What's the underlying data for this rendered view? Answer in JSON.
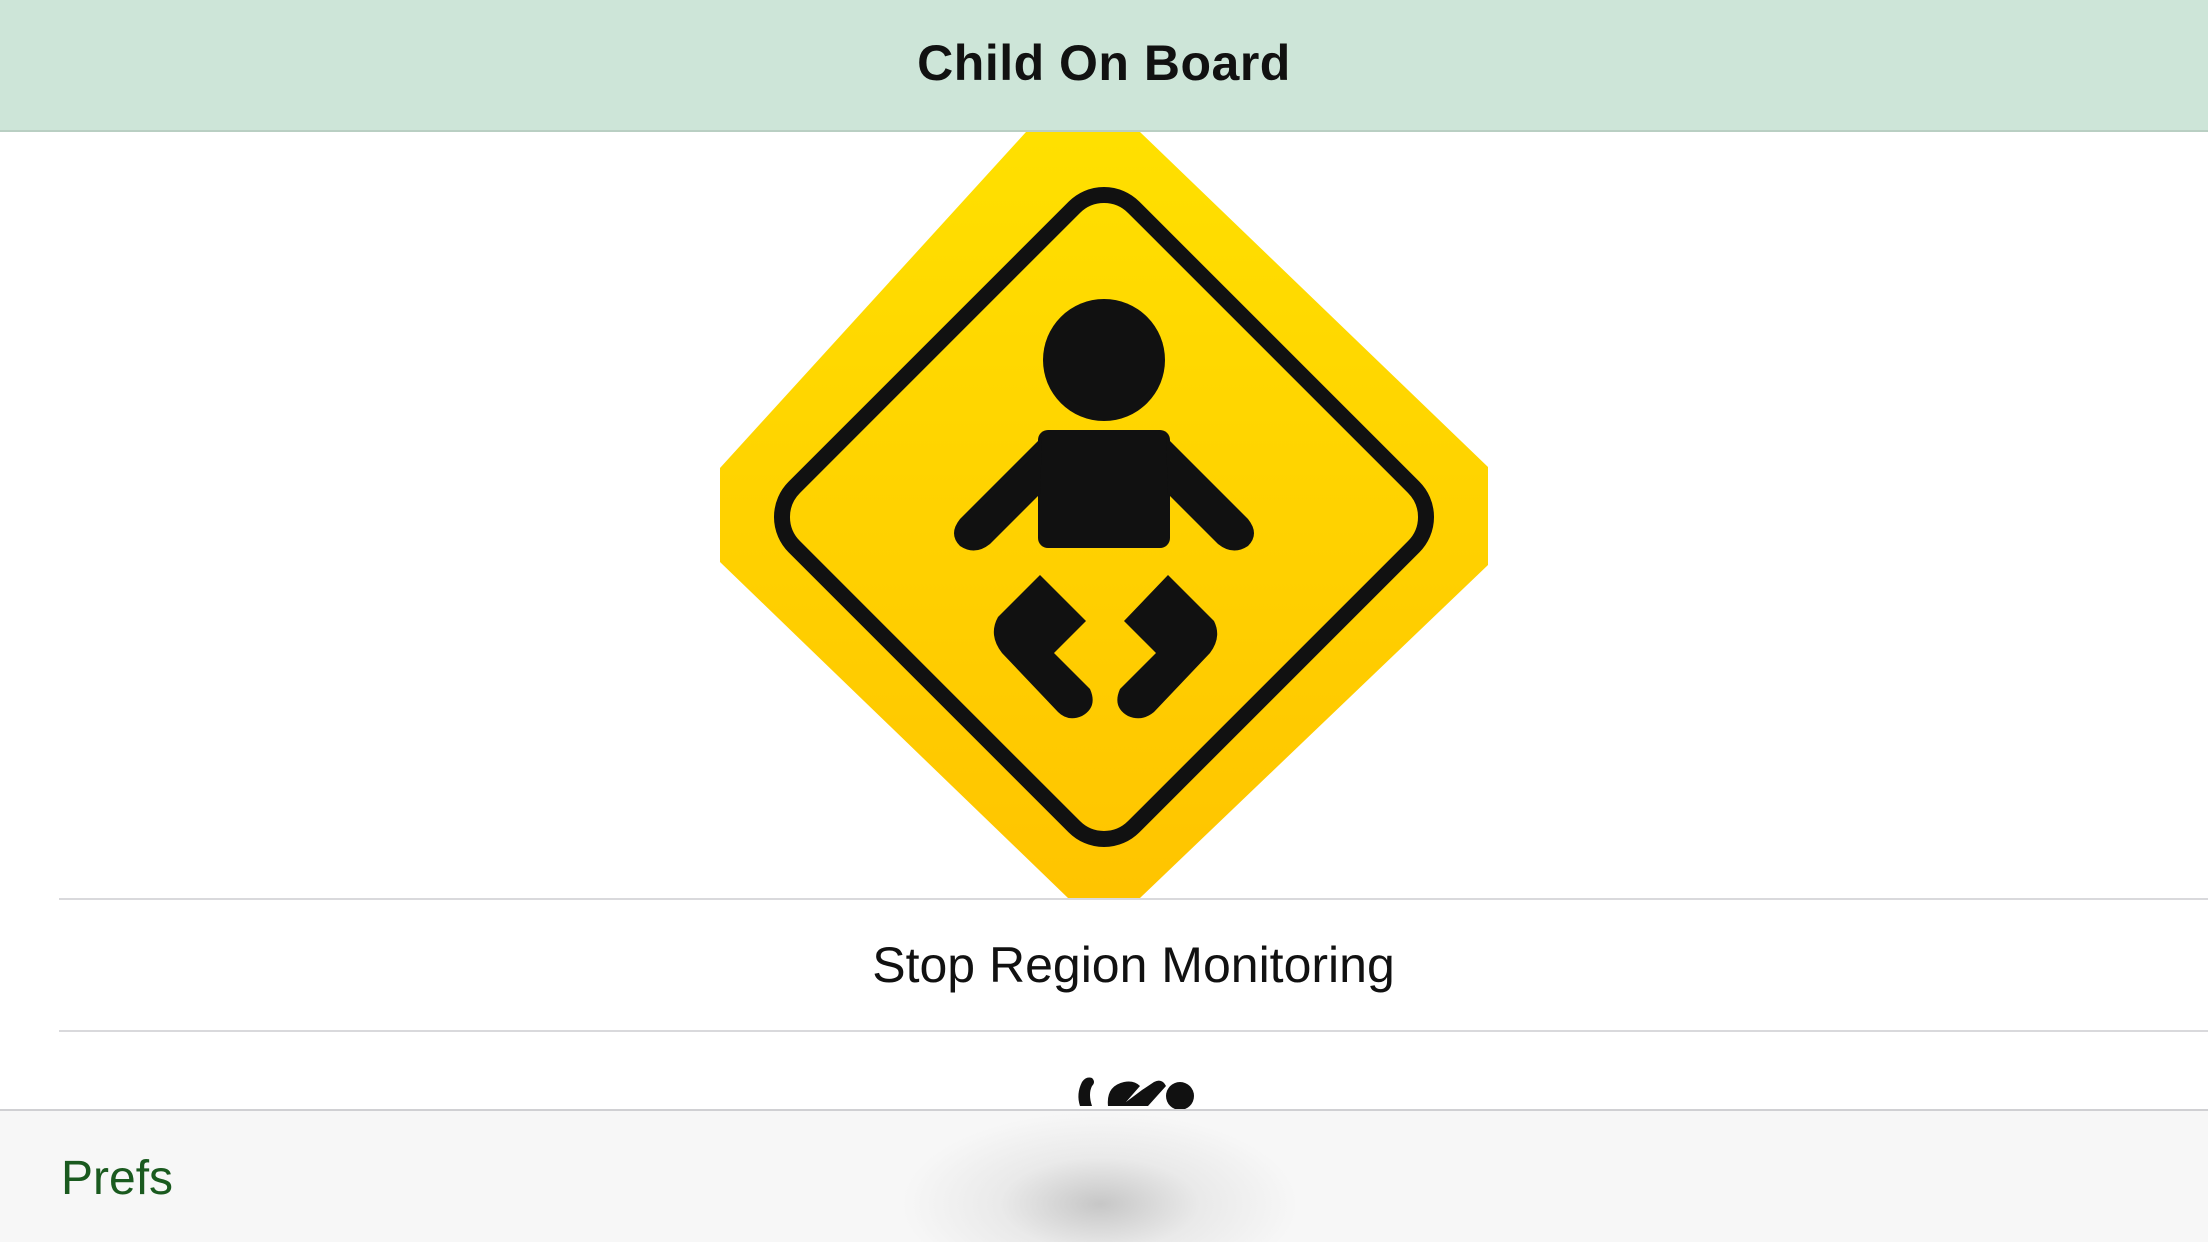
{
  "nav": {
    "title": "Child On Board"
  },
  "sign": {
    "icon": "child-on-board-sign-icon",
    "colors": {
      "yellow_top": "#ffe000",
      "yellow_bottom": "#ffc400",
      "symbol": "#111111"
    }
  },
  "actions": {
    "stop_monitoring_label": "Stop Region Monitoring"
  },
  "toolbar": {
    "prefs_label": "Prefs",
    "accent_color": "#1a5a1f"
  },
  "theme": {
    "nav_background": "#cde5d8",
    "toolbar_background": "#f7f7f7"
  }
}
